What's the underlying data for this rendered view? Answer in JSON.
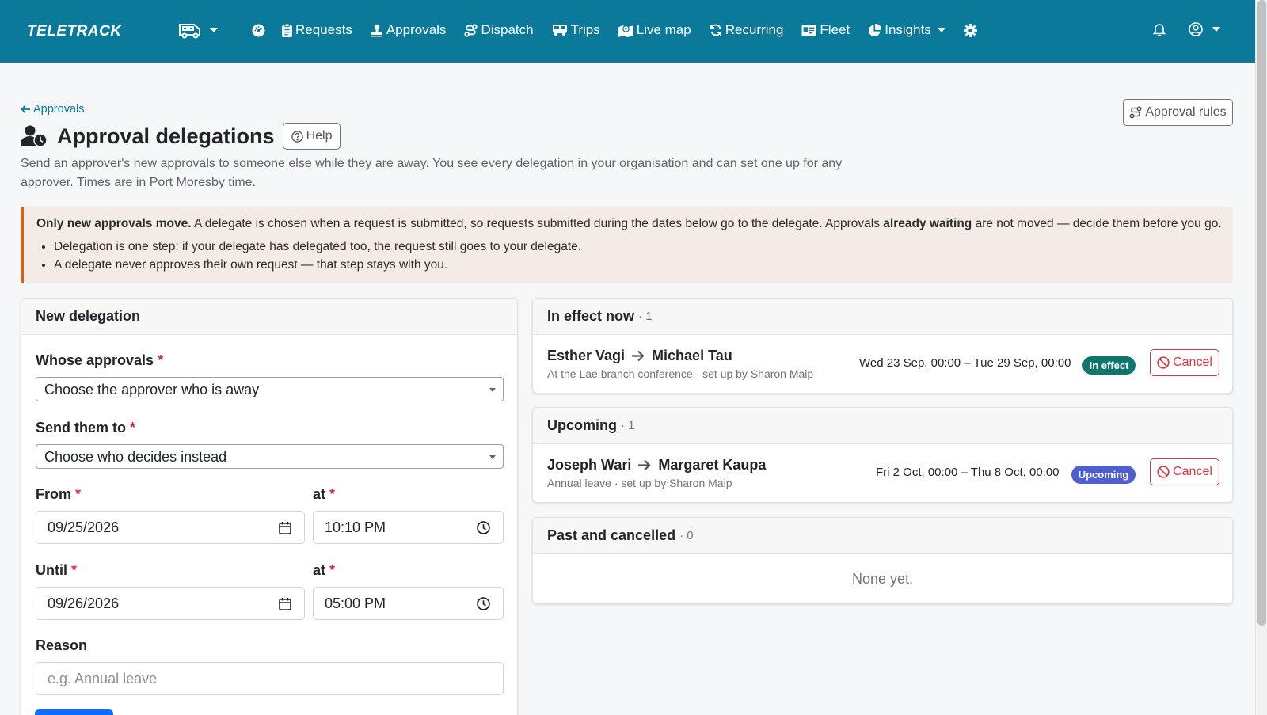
{
  "navbar": {
    "brand": "TELETRACK",
    "items": [
      {
        "label": "Requests"
      },
      {
        "label": "Approvals"
      },
      {
        "label": "Dispatch"
      },
      {
        "label": "Trips"
      },
      {
        "label": "Live map"
      },
      {
        "label": "Recurring"
      },
      {
        "label": "Fleet"
      },
      {
        "label": "Insights"
      }
    ]
  },
  "page": {
    "back_label": "Approvals",
    "title": "Approval delegations",
    "help_label": "Help",
    "rules_label": "Approval rules",
    "intro": "Send an approver's new approvals to someone else while they are away. You see every delegation in your organisation and can set one up for any approver. Times are in Port Moresby time."
  },
  "alert": {
    "lead_bold": "Only new approvals move.",
    "lead_text": " A delegate is chosen when a request is submitted, so requests submitted during the dates below go to the delegate. Approvals ",
    "mid_bold": "already waiting",
    "tail_text": " are not moved — decide them before you go.",
    "bullets": [
      "Delegation is one step: if your delegate has delegated too, the request still goes to your delegate.",
      "A delegate never approves their own request — that step stays with you."
    ]
  },
  "form": {
    "title": "New delegation",
    "whose_label": "Whose approvals",
    "whose_placeholder": "Choose the approver who is away",
    "send_label": "Send them to",
    "send_placeholder": "Choose who decides instead",
    "from_label": "From",
    "from_date": "09/25/2026",
    "from_at_label": "at",
    "from_time": "10:10 PM",
    "until_label": "Until",
    "until_date": "09/26/2026",
    "until_at_label": "at",
    "until_time": "05:00 PM",
    "reason_label": "Reason",
    "reason_placeholder": "e.g. Annual leave",
    "required_mark": "*"
  },
  "sections": {
    "in_effect": {
      "title": "In effect now",
      "count": "· 1",
      "rows": [
        {
          "from": "Esther Vagi",
          "to": "Michael Tau",
          "sub": "At the Lae branch conference · set up by Sharon Maip",
          "range": "Wed 23 Sep, 00:00 – Tue 29 Sep, 00:00",
          "badge": "In effect",
          "cancel": "Cancel"
        }
      ]
    },
    "upcoming": {
      "title": "Upcoming",
      "count": "· 1",
      "rows": [
        {
          "from": "Joseph Wari",
          "to": "Margaret Kaupa",
          "sub": "Annual leave · set up by Sharon Maip",
          "range": "Fri 2 Oct, 00:00 – Thu 8 Oct, 00:00",
          "badge": "Upcoming",
          "cancel": "Cancel"
        }
      ]
    },
    "past": {
      "title": "Past and cancelled",
      "count": "· 0",
      "empty": "None yet."
    }
  },
  "colors": {
    "navbar": "#0b7a9a",
    "in_effect_badge": "#0f766e",
    "upcoming_badge": "#4f5fd1",
    "danger": "#dc3545",
    "alert_border": "#d0641d",
    "alert_bg": "#f5ebe6"
  }
}
